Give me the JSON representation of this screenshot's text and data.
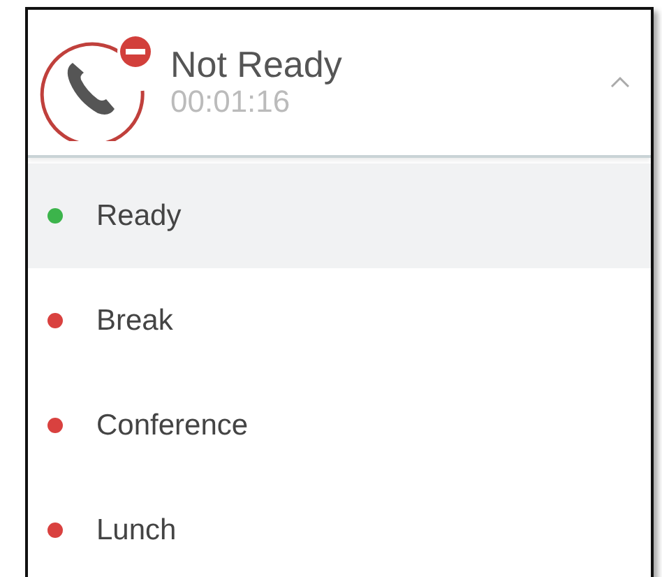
{
  "status": {
    "label": "Not Ready",
    "timer": "00:01:16",
    "expanded": true
  },
  "states": [
    {
      "label": "Ready",
      "color": "#3cb44b",
      "selected": true
    },
    {
      "label": "Break",
      "color": "#d9413f",
      "selected": false
    },
    {
      "label": "Conference",
      "color": "#d9413f",
      "selected": false
    },
    {
      "label": "Lunch",
      "color": "#d9413f",
      "selected": false
    }
  ]
}
